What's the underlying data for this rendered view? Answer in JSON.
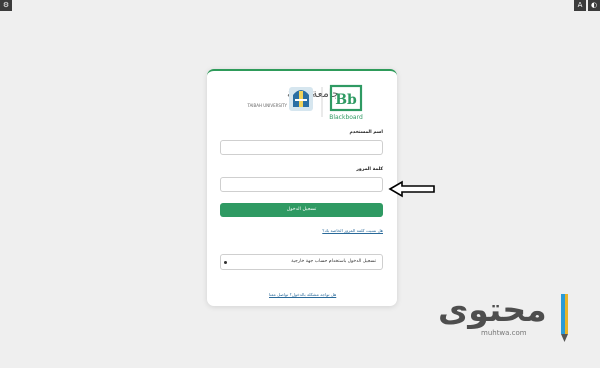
{
  "window_controls": {
    "left_icon": "settings-icon",
    "right_icon_text_size": "A",
    "right_icon_contrast": "contrast-icon"
  },
  "branding": {
    "university_name_ar": "جامعة طيبة",
    "university_name_en": "TAIBAH UNIVERSITY",
    "bb_mark": "Bb",
    "bb_name": "Blackboard",
    "accent_color": "#2f9a63"
  },
  "login": {
    "username_label": "اسم المستخدم",
    "username_value": "",
    "password_label": "كلمة المرور",
    "password_value": "",
    "submit_label": "تسجيل الدخول",
    "forgot_link": "هل نسيت كلمة المرور الخاصة بك؟",
    "external_login_label": "تسجيل الدخول باستخدام حساب جهة خارجية",
    "help_link": "هل تواجه مشكلة بالدخول؟ تواصل معنا"
  },
  "watermark": {
    "text": "محتوى",
    "domain": "muhtwa.com"
  }
}
